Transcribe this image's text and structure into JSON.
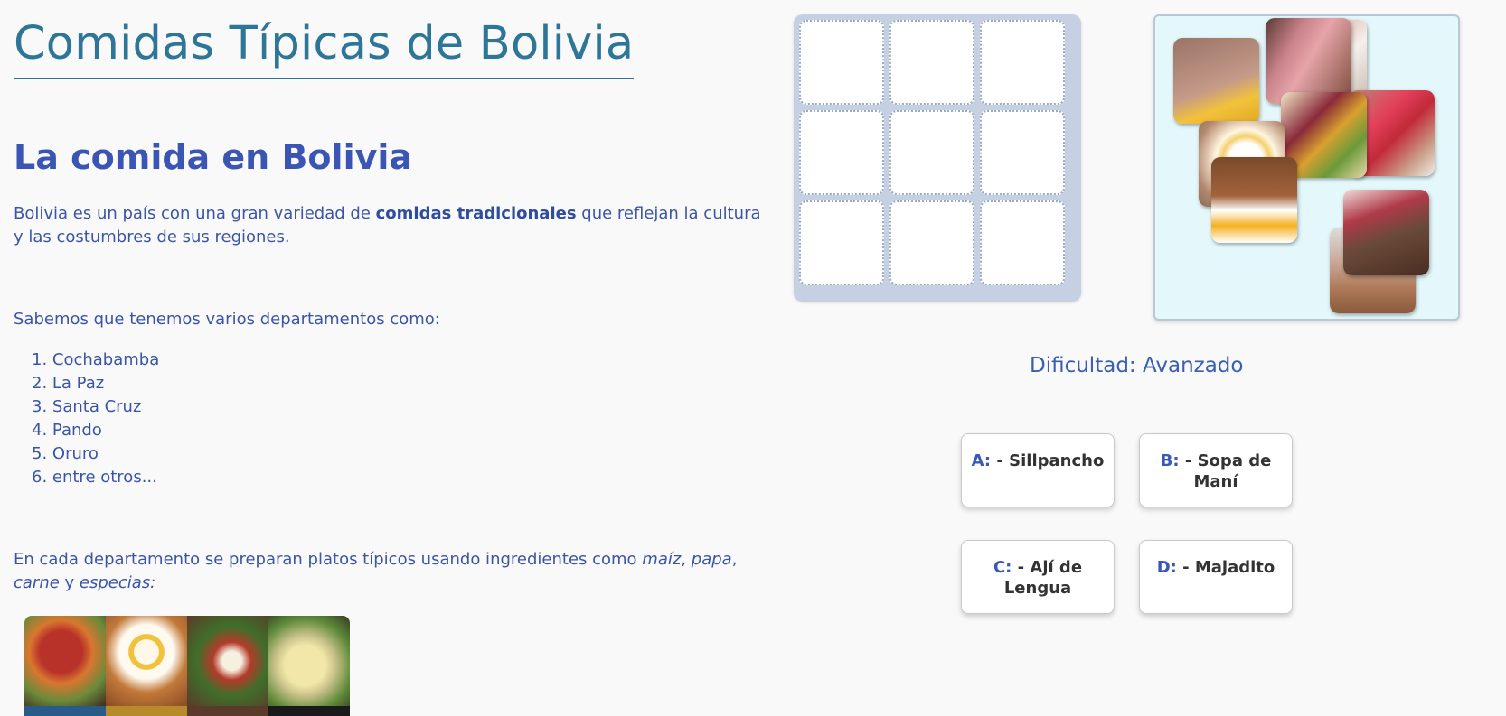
{
  "article": {
    "title": "Comidas Típicas de Bolivia",
    "section_title": "La comida en Bolivia",
    "intro_before": "Bolivia es un país con una gran variedad de ",
    "intro_bold": "comidas tradicionales",
    "intro_after": " que reflejan la cultura y las costumbres de sus regiones.",
    "departments_intro": "Sabemos que tenemos varios departamentos como:",
    "departments": [
      "1. Cochabamba",
      "2. La Paz",
      "3. Santa Cruz",
      "4. Pando",
      "5. Oruro",
      "6. entre otros..."
    ],
    "ingredients_before": "En cada departamento se preparan platos típicos usando ingredientes como ",
    "ing1": "maíz",
    "sep1": ", ",
    "ing2": "papa",
    "sep2": ", ",
    "ing3": "carne",
    "sep3": " y ",
    "ing4": "especias:"
  },
  "game": {
    "difficulty": "Dificultad: Avanzado",
    "options": [
      {
        "key": "A:",
        "label": " - Sillpancho"
      },
      {
        "key": "B:",
        "label": " - Sopa de Maní"
      },
      {
        "key": "C:",
        "label": " - Ají de Lengua"
      },
      {
        "key": "D:",
        "label": " - Majadito"
      }
    ]
  },
  "colors": {
    "title": "#2e7698",
    "text": "#3a55a8",
    "board_bg": "#c5d1e2",
    "tray_bg": "#e4f8fb"
  }
}
